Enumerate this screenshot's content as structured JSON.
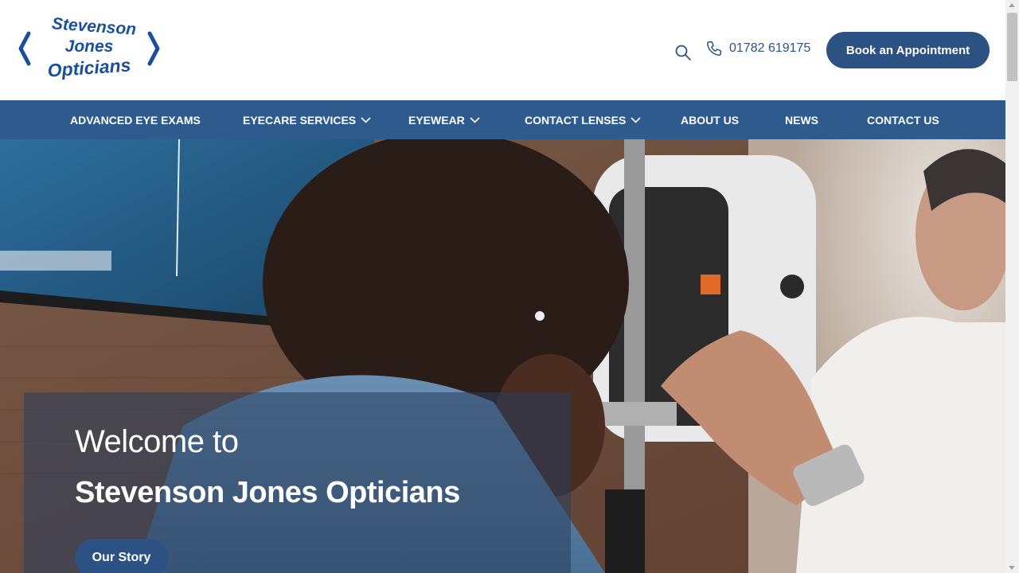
{
  "header": {
    "logo": {
      "line1": "Stevenson",
      "line2": "Jones",
      "line3": "Opticians"
    },
    "search_icon": "search-icon",
    "phone": "01782 619175",
    "book_button": "Book an Appointment"
  },
  "nav": {
    "items": [
      {
        "label": "ADVANCED EYE EXAMS",
        "dropdown": false
      },
      {
        "label": "EYECARE SERVICES",
        "dropdown": true
      },
      {
        "label": "EYEWEAR",
        "dropdown": true
      },
      {
        "label": "CONTACT LENSES",
        "dropdown": true
      },
      {
        "label": "ABOUT US",
        "dropdown": false
      },
      {
        "label": "NEWS",
        "dropdown": false
      },
      {
        "label": "CONTACT US",
        "dropdown": false
      }
    ]
  },
  "hero": {
    "welcome": "Welcome to",
    "title": "Stevenson Jones Opticians",
    "button": "Our Story"
  },
  "colors": {
    "brand": "#2b5283",
    "nav": "#2e5a8d",
    "logo": "#1a4f9c"
  }
}
